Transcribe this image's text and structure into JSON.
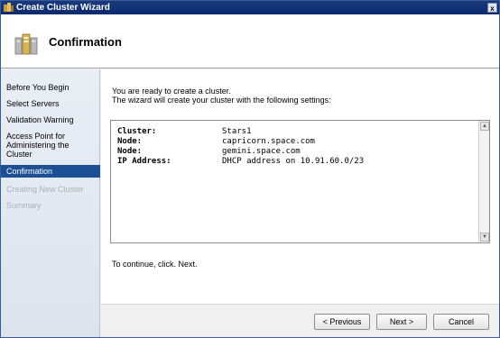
{
  "window": {
    "title": "Create Cluster Wizard",
    "close_label": "x"
  },
  "header": {
    "title": "Confirmation"
  },
  "nav": {
    "items": [
      {
        "label": "Before You Begin"
      },
      {
        "label": "Select Servers"
      },
      {
        "label": "Validation Warning"
      },
      {
        "label": "Access Point for Administering the Cluster"
      },
      {
        "label": "Confirmation"
      },
      {
        "label": "Creating New Cluster"
      },
      {
        "label": "Summary"
      }
    ]
  },
  "content": {
    "intro_line1": "You are ready to create a cluster.",
    "intro_line2": "The wizard will create your cluster with the following settings:",
    "settings": [
      {
        "key": "Cluster:",
        "value": "Stars1"
      },
      {
        "key": "Node:",
        "value": "capricorn.space.com"
      },
      {
        "key": "Node:",
        "value": "gemini.space.com"
      },
      {
        "key": "IP Address:",
        "value": "DHCP address on 10.91.60.0/23"
      }
    ],
    "continue_text": "To continue, click. Next."
  },
  "buttons": {
    "previous": "< Previous",
    "next": "Next >",
    "cancel": "Cancel"
  }
}
